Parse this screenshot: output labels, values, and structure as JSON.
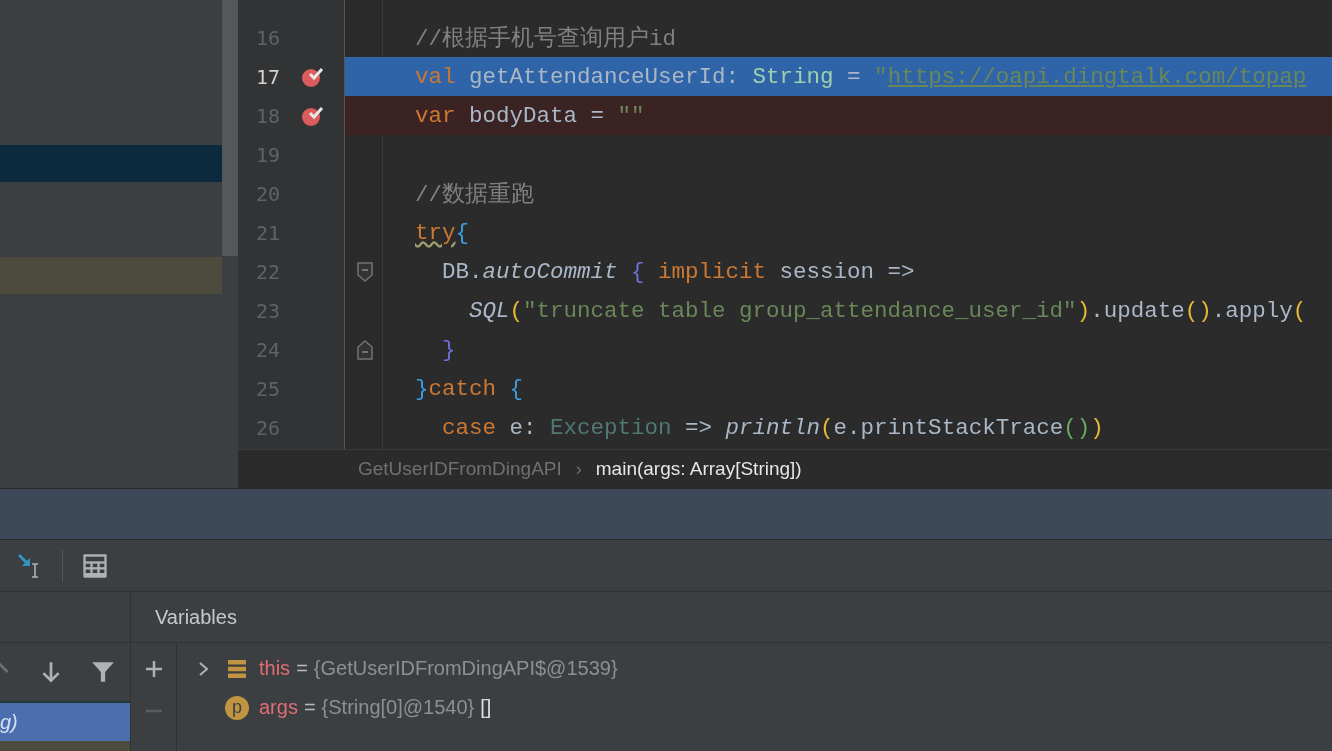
{
  "structure_panel": {
    "rows": [
      {
        "selected": true
      },
      {
        "selected": false
      }
    ]
  },
  "editor": {
    "lines": [
      {
        "number": "16",
        "breakpoint": false,
        "current": false,
        "fold_start": false,
        "fold_end": false,
        "tokens": [
          {
            "kind": "comment",
            "text": "//根据手机号查询用户id"
          }
        ]
      },
      {
        "number": "17",
        "breakpoint": true,
        "current": true,
        "fold_start": false,
        "fold_end": false,
        "tokens": [
          {
            "kind": "keyword",
            "text": "val"
          },
          {
            "kind": "plain",
            "text": " getAttendanceUserId: "
          },
          {
            "kind": "type",
            "text": "String"
          },
          {
            "kind": "plain",
            "text": " = "
          },
          {
            "kind": "string",
            "text": "\""
          },
          {
            "kind": "link",
            "text": "https://oapi.dingtalk.com/topap"
          }
        ]
      },
      {
        "number": "18",
        "breakpoint": true,
        "current": false,
        "fold_start": false,
        "fold_end": false,
        "tokens": [
          {
            "kind": "keyword",
            "text": "var"
          },
          {
            "kind": "plain",
            "text": " bodyData = "
          },
          {
            "kind": "string",
            "text": "\"\""
          }
        ]
      },
      {
        "number": "19",
        "breakpoint": false,
        "current": false,
        "fold_start": false,
        "fold_end": false
      },
      {
        "number": "20",
        "breakpoint": false,
        "current": false,
        "fold_start": false,
        "fold_end": false,
        "tokens": [
          {
            "kind": "comment",
            "text": "//数据重跑"
          }
        ]
      },
      {
        "number": "21",
        "breakpoint": false,
        "current": false,
        "fold_start": false,
        "fold_end": false,
        "tokens": [
          {
            "kind": "flagged",
            "text": "try"
          },
          {
            "kind": "brace",
            "text": "{"
          }
        ]
      },
      {
        "number": "22",
        "breakpoint": false,
        "current": false,
        "fold_start": true,
        "fold_end": false,
        "tokens": [
          {
            "kind": "plain",
            "text": "  DB."
          },
          {
            "kind": "italic",
            "text": "autoCommit"
          },
          {
            "kind": "brace2",
            "text": " {"
          },
          {
            "kind": "keyword",
            "text": " implicit"
          },
          {
            "kind": "plain",
            "text": " session =>"
          }
        ]
      },
      {
        "number": "23",
        "breakpoint": false,
        "current": false,
        "fold_start": false,
        "fold_end": false,
        "tokens": [
          {
            "kind": "italic",
            "text": "    SQL"
          },
          {
            "kind": "paren",
            "text": "("
          },
          {
            "kind": "string",
            "text": "\"truncate table group_attendance_user_id\""
          },
          {
            "kind": "paren",
            "text": ")"
          },
          {
            "kind": "plain",
            "text": ".update"
          },
          {
            "kind": "paren",
            "text": "()"
          },
          {
            "kind": "plain",
            "text": ".apply"
          },
          {
            "kind": "paren",
            "text": "("
          }
        ]
      },
      {
        "number": "24",
        "breakpoint": false,
        "current": false,
        "fold_start": false,
        "fold_end": true,
        "tokens": [
          {
            "kind": "brace2",
            "text": "  }"
          }
        ]
      },
      {
        "number": "25",
        "breakpoint": false,
        "current": false,
        "fold_start": false,
        "fold_end": false,
        "tokens": [
          {
            "kind": "brace",
            "text": "}"
          },
          {
            "kind": "keyword",
            "text": "catch"
          },
          {
            "kind": "brace",
            "text": " {"
          }
        ]
      },
      {
        "number": "26",
        "breakpoint": false,
        "current": false,
        "fold_start": false,
        "fold_end": false,
        "tokens": [
          {
            "kind": "keyword",
            "text": "  case"
          },
          {
            "kind": "plain",
            "text": " e: "
          },
          {
            "kind": "type",
            "text": "Exception"
          },
          {
            "kind": "plain",
            "text": " => "
          },
          {
            "kind": "italic",
            "text": "println"
          },
          {
            "kind": "paren",
            "text": "("
          },
          {
            "kind": "plain",
            "text": "e.printStackTrace"
          },
          {
            "kind": "paren2",
            "text": "()"
          },
          {
            "kind": "paren",
            "text": ")"
          }
        ]
      }
    ]
  },
  "breadcrumbs": {
    "separator": "›",
    "items": [
      {
        "label": "GetUserIDFromDingAPI",
        "current": false
      },
      {
        "label": "main(args: Array[String])",
        "current": true
      }
    ]
  },
  "frames": {
    "items": [
      {
        "label": "g)",
        "selected": true
      }
    ]
  },
  "variables": {
    "title": "Variables",
    "items": [
      {
        "kind": "field",
        "expandable": true,
        "name": "this",
        "operator": "=",
        "value": "{GetUserIDFromDingAPI$@1539}"
      },
      {
        "kind": "parameter",
        "badge": "p",
        "expandable": false,
        "name": "args",
        "operator": "=",
        "value": "{String[0]@1540}",
        "suffix": "[]"
      }
    ]
  }
}
